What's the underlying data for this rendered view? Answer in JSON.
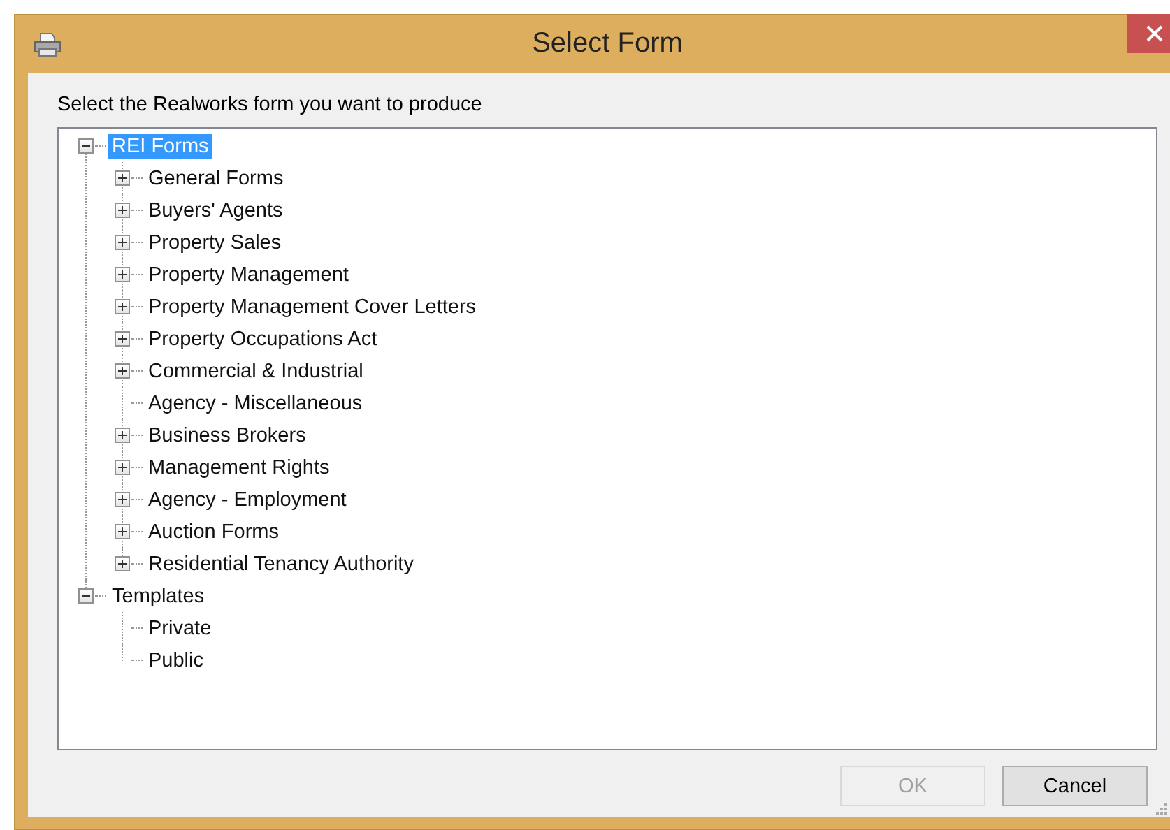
{
  "window": {
    "title": "Select Form"
  },
  "prompt": "Select the Realworks form you want to produce",
  "tree": [
    {
      "label": "REI Forms",
      "selected": true,
      "kind": "folder",
      "expanded": true,
      "children": [
        {
          "label": "General Forms",
          "selected": false,
          "kind": "folder",
          "expanded": false
        },
        {
          "label": "Buyers' Agents",
          "selected": false,
          "kind": "folder",
          "expanded": false
        },
        {
          "label": "Property Sales",
          "selected": false,
          "kind": "folder",
          "expanded": false
        },
        {
          "label": "Property Management",
          "selected": false,
          "kind": "folder",
          "expanded": false
        },
        {
          "label": "Property Management Cover Letters",
          "selected": false,
          "kind": "folder",
          "expanded": false
        },
        {
          "label": "Property Occupations Act",
          "selected": false,
          "kind": "folder",
          "expanded": false
        },
        {
          "label": "Commercial & Industrial",
          "selected": false,
          "kind": "folder",
          "expanded": false
        },
        {
          "label": "Agency - Miscellaneous",
          "selected": false,
          "kind": "leaf"
        },
        {
          "label": "Business Brokers",
          "selected": false,
          "kind": "folder",
          "expanded": false
        },
        {
          "label": "Management Rights",
          "selected": false,
          "kind": "folder",
          "expanded": false
        },
        {
          "label": "Agency - Employment",
          "selected": false,
          "kind": "folder",
          "expanded": false
        },
        {
          "label": "Auction Forms",
          "selected": false,
          "kind": "folder",
          "expanded": false
        },
        {
          "label": "Residential Tenancy Authority",
          "selected": false,
          "kind": "folder",
          "expanded": false
        }
      ]
    },
    {
      "label": "Templates",
      "selected": false,
      "kind": "folder",
      "expanded": true,
      "children": [
        {
          "label": "Private",
          "selected": false,
          "kind": "leaf"
        },
        {
          "label": "Public",
          "selected": false,
          "kind": "leaf"
        }
      ]
    }
  ],
  "buttons": [
    {
      "label": "OK",
      "disabled": true
    },
    {
      "label": "Cancel",
      "disabled": false
    }
  ]
}
